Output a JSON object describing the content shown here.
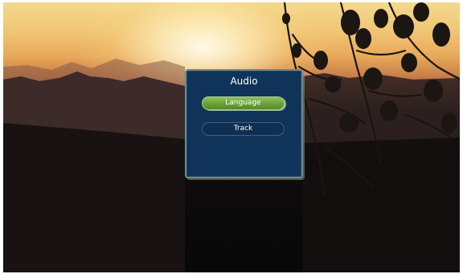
{
  "dialog": {
    "title": "Audio",
    "items": [
      {
        "label": "Language",
        "selected": true
      },
      {
        "label": "Track",
        "selected": false
      }
    ]
  },
  "colors": {
    "dialog_background": "#10335a",
    "dialog_border": "#6b8a8c",
    "selected_item": "#6aa03a",
    "text": "#ffffff"
  },
  "background": {
    "scene": "sunset-mountains-with-tree-silhouette"
  }
}
